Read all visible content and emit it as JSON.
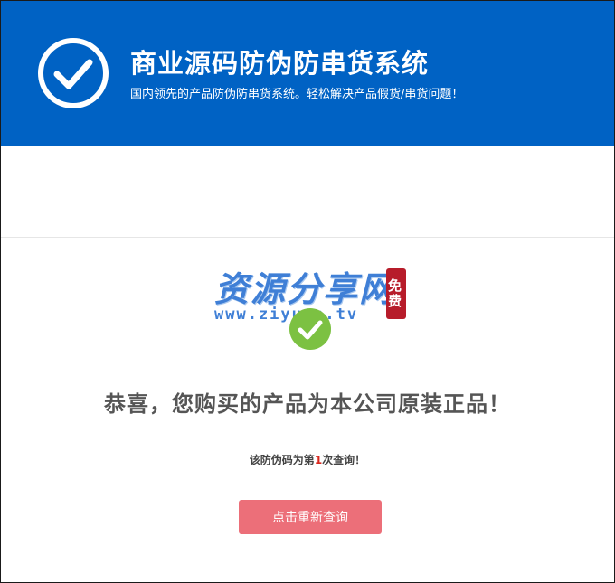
{
  "header": {
    "title": "商业源码防伪防串货系统",
    "subtitle": "国内领先的产品防伪防串货系统。轻松解决产品假货/串货问题！",
    "background_color": "#0062c4",
    "icon": "check-circle-icon"
  },
  "watermark": {
    "main_text": "资源分享网",
    "url_text": "www.ziyuan.tv",
    "seal_text": "免费"
  },
  "result": {
    "icon": "green-check-icon",
    "message": "恭喜，您购买的产品为本公司原装正品！",
    "query_prefix": "该防伪码为第",
    "query_count": "1",
    "query_suffix": "次查询！"
  },
  "actions": {
    "requery_label": "点击重新查询",
    "button_color": "#ec6f79"
  }
}
